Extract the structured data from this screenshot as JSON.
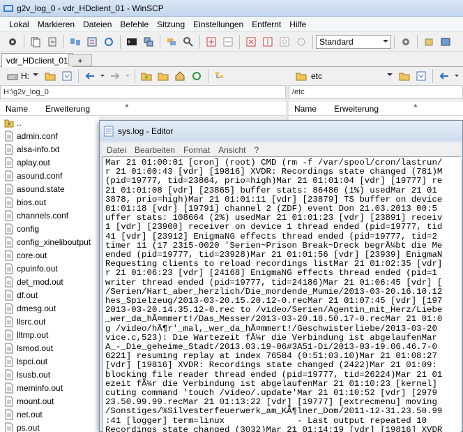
{
  "window": {
    "title": "g2v_log_0 - vdr_HDclient_01 - WinSCP"
  },
  "menubar": {
    "items": [
      "Lokal",
      "Markieren",
      "Dateien",
      "Befehle",
      "Sitzung",
      "Einstellungen",
      "Entfernt",
      "Hilfe"
    ]
  },
  "toolbar": {
    "transfer_setting": "Standard"
  },
  "tabs": {
    "active": "vdr_HDclient_01",
    "new_tab": "+"
  },
  "left_panel": {
    "drive": "H:",
    "path": "H:\\g2v_log_0",
    "col_name": "Name",
    "col_ext": "Erweiterung",
    "files": [
      {
        "name": "..",
        "type": "up"
      },
      {
        "name": "admin.conf",
        "type": "file"
      },
      {
        "name": "alsa-info.txt",
        "type": "file"
      },
      {
        "name": "aplay.out",
        "type": "file"
      },
      {
        "name": "asound.conf",
        "type": "file"
      },
      {
        "name": "asound.state",
        "type": "file"
      },
      {
        "name": "bios.out",
        "type": "file"
      },
      {
        "name": "channels.conf",
        "type": "file"
      },
      {
        "name": "config",
        "type": "file"
      },
      {
        "name": "config_xineliboutput",
        "type": "file"
      },
      {
        "name": "core.out",
        "type": "file"
      },
      {
        "name": "cpuinfo.out",
        "type": "file"
      },
      {
        "name": "det_mod.out",
        "type": "file"
      },
      {
        "name": "df.out",
        "type": "file"
      },
      {
        "name": "dmesg.out",
        "type": "file"
      },
      {
        "name": "llsrc.out",
        "type": "file"
      },
      {
        "name": "lltmp.out",
        "type": "file"
      },
      {
        "name": "lsmod.out",
        "type": "file"
      },
      {
        "name": "lspci.out",
        "type": "file"
      },
      {
        "name": "lsusb.out",
        "type": "file"
      },
      {
        "name": "meminfo.out",
        "type": "file"
      },
      {
        "name": "mount.out",
        "type": "file"
      },
      {
        "name": "net.out",
        "type": "file"
      },
      {
        "name": "ps.out",
        "type": "file"
      }
    ]
  },
  "right_panel": {
    "folder": "etc",
    "path": "/etc",
    "col_name": "Name",
    "col_ext": "Erweiterung"
  },
  "notepad": {
    "title": "sys.log - Editor",
    "menu": [
      "Datei",
      "Bearbeiten",
      "Format",
      "Ansicht",
      "?"
    ],
    "lines": [
      "Mar 21 01:00:01 [cron] (root) CMD (rm -f /var/spool/cron/lastrun/",
      "r 21 01:00:43 [vdr] [19816] XVDR: Recordings state changed (781)M",
      "(pid=19777, tid=23864, prio=high)Mar 21 01:01:04 [vdr] [19777] re",
      "21 01:01:08 [vdr] [23865] buffer stats: 86480 (1%) usedMar 21 01",
      "3878, prio=high)Mar 21 01:01:11 [vdr] [23879] TS buffer on device",
      "01:01:18 [vdr] [19791] channel 2 (ZDF) event Don 21.03.2013 00:5",
      "uffer stats: 108664 (2%) usedMar 21 01:01:23 [vdr] [23891] receiv",
      "1 [vdr] [23900] receiver on device 1 thread ended (pid=19777, tid",
      "41 [vdr] [23912] EnigmaNG effects thread ended (pid=19777, tid=2",
      "timer 11 (17 2315-0020 'Serien~Prison Break~Dreck begrÃ¼bt die Me",
      "ended (pid=19777, tid=23928)Mar 21 01:01:56 [vdr] [23939] EnigmaN",
      "Requesting clients to reload recordings listMar 21 01:02:35 [vdr]",
      "r 21 01:06:23 [vdr] [24168] EnigmaNG effects thread ended (pid=1",
      "writer thread ended (pid=19777, tid=24186)Mar 21 01:06:45 [vdr] [",
      "/Serien/Hart_aber_herzlich/Die_mordende_Mumie/2013-03-20.16.10.12",
      "hes_Spielzeug/2013-03-20.15.20.12-0.recMar 21 01:07:45 [vdr] [197",
      "2013-03-20.14.35.12-0.rec to /video/Serien/Agentin_mit_Herz/Liebe",
      "_wer_da_hÃ¤mmert!/Das_Messer/2013-03-20.18.50.17-0.recMar 21 01:0",
      "g /video/hÃ¶r'_mal,_wer_da_hÃ¤mmert!/Geschwisterliebe/2013-03-20",
      "vice.c,523): Die Wartezeit fÃ¼r die Verbindung ist abgelaufenMar",
      "A_-_Die_geheime_Stadt/2013.03.19-06#3A51-Di/2013-03-19.06.46.7-0",
      "6221] resuming replay at index 76584 (0:51:03.10)Mar 21 01:08:27",
      "[vdr] [19816] XVDR: Recordings state changed (2422)Mar 21 01:09:",
      "blocking file reader thread ended (pid=19777, tid=26224)Mar 21 01",
      "ezeit fÃ¼r die Verbindung ist abgelaufenMar 21 01:10:23 [kernel]",
      "cuting command 'touch /video/.update'Mar 21 01:10:52 [vdr] [2979",
      "23.50.99.99.recMar 21 01:13:22 [vdr] [19777] [extrecmenu] moving",
      "/Sonstiges/%Silvesterfeuerwerk_am_KÃ¶lner_Dom/2011-12-31.23.50.99",
      ":41 [logger] term=linux              - Last output repeated 10",
      "Recordings state changed (3032)Mar 21 01:14:19 [vdr] [19816] XVDR",
      "  ...           -  -  -    ... ...  ...  .  -  ...  ...   ..."
    ]
  }
}
